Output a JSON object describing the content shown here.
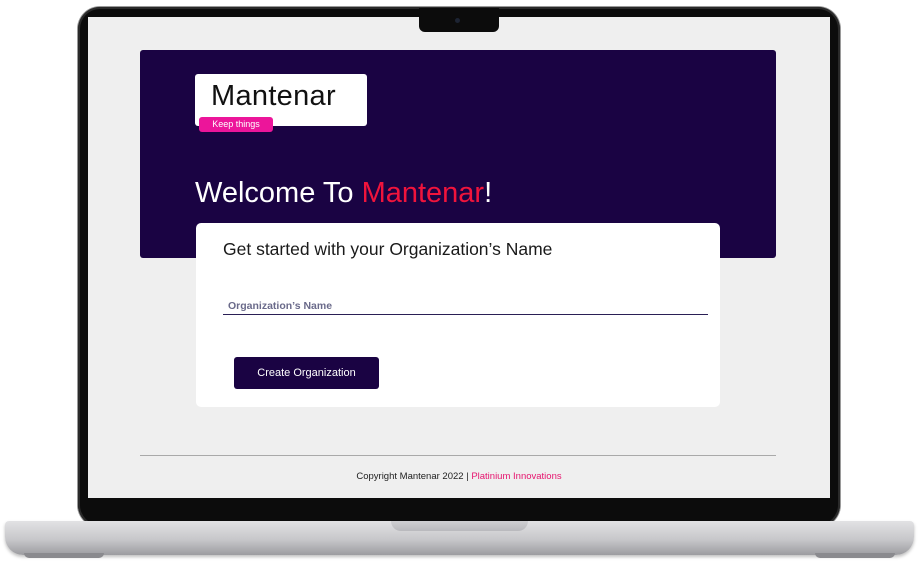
{
  "brand": {
    "name": "Mantenar",
    "tagline": "Keep things"
  },
  "hero": {
    "welcome_prefix": "Welcome To ",
    "welcome_brand": "Mantenar",
    "welcome_suffix": "!"
  },
  "form": {
    "title": "Get started with your Organization’s Name",
    "org_name_placeholder": "Organization’s Name",
    "org_name_value": "",
    "submit_label": "Create Organization"
  },
  "footer": {
    "copyright": "Copyright  Mantenar 2022 | ",
    "company": "Platinium Innovations"
  },
  "colors": {
    "primary_dark": "#1a0343",
    "accent_red": "#f0143c",
    "accent_pink": "#ec159a",
    "screen_bg": "#efefef"
  },
  "icons": [
    "laptop-frame",
    "camera-icon"
  ]
}
